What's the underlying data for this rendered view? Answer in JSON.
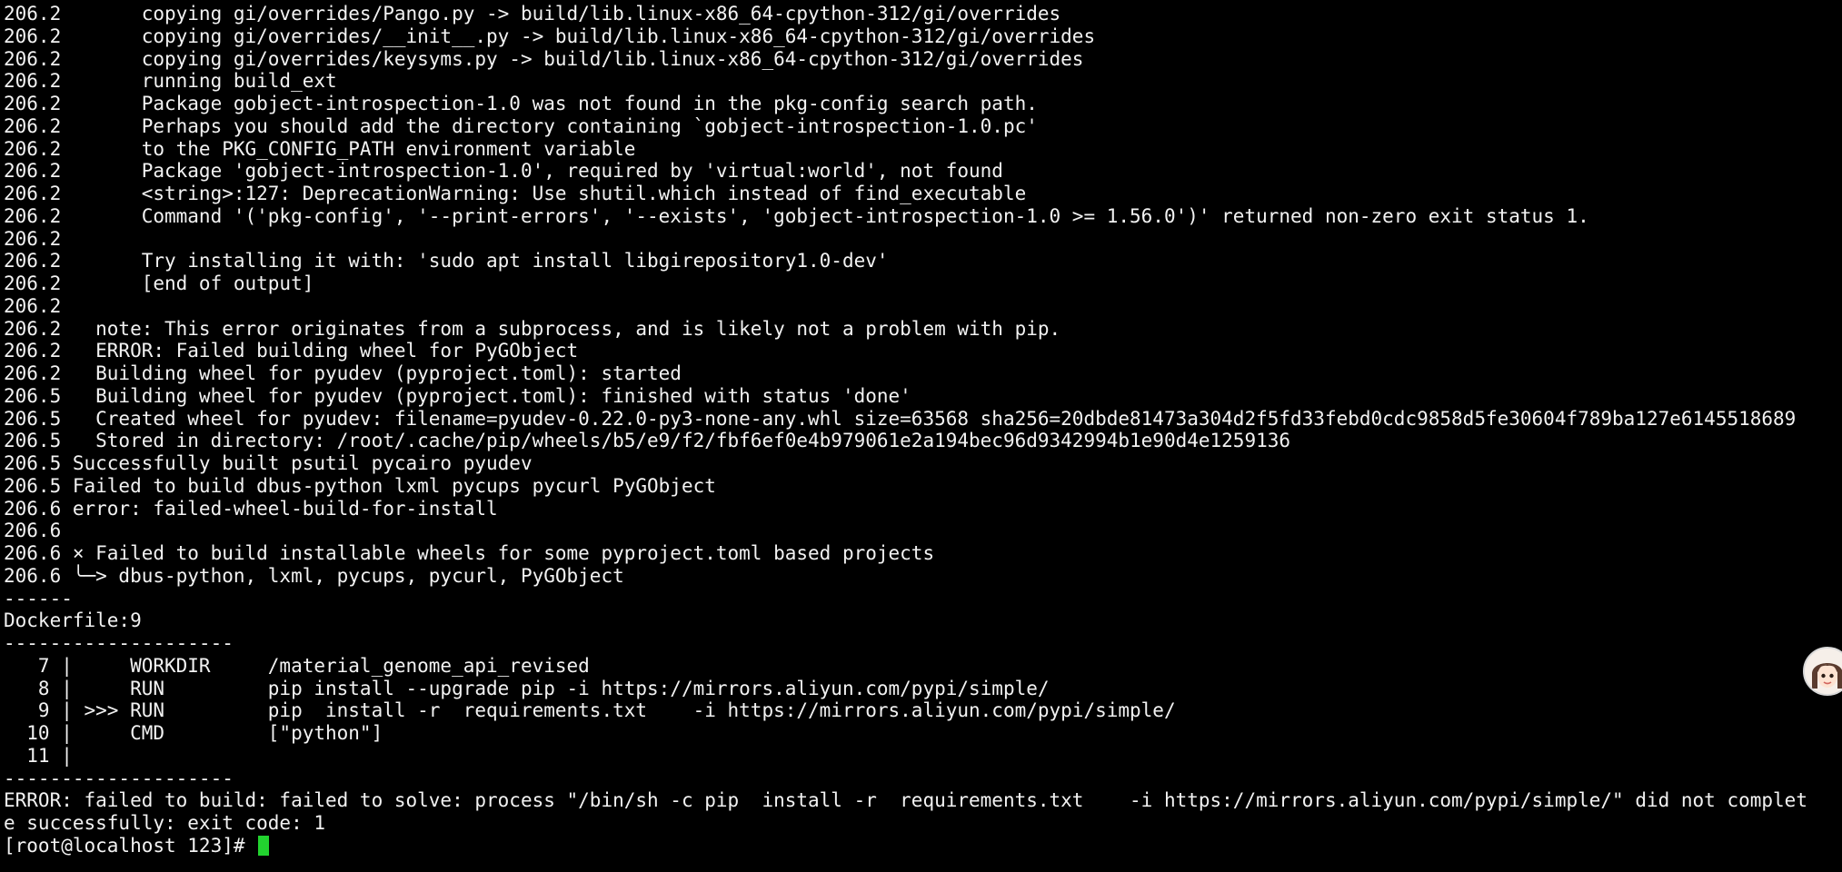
{
  "terminal": {
    "lines": [
      "206.2       copying gi/overrides/Pango.py -> build/lib.linux-x86_64-cpython-312/gi/overrides",
      "206.2       copying gi/overrides/__init__.py -> build/lib.linux-x86_64-cpython-312/gi/overrides",
      "206.2       copying gi/overrides/keysyms.py -> build/lib.linux-x86_64-cpython-312/gi/overrides",
      "206.2       running build_ext",
      "206.2       Package gobject-introspection-1.0 was not found in the pkg-config search path.",
      "206.2       Perhaps you should add the directory containing `gobject-introspection-1.0.pc'",
      "206.2       to the PKG_CONFIG_PATH environment variable",
      "206.2       Package 'gobject-introspection-1.0', required by 'virtual:world', not found",
      "206.2       <string>:127: DeprecationWarning: Use shutil.which instead of find_executable",
      "206.2       Command '('pkg-config', '--print-errors', '--exists', 'gobject-introspection-1.0 >= 1.56.0')' returned non-zero exit status 1.",
      "206.2",
      "206.2       Try installing it with: 'sudo apt install libgirepository1.0-dev'",
      "206.2       [end of output]",
      "206.2",
      "206.2   note: This error originates from a subprocess, and is likely not a problem with pip.",
      "206.2   ERROR: Failed building wheel for PyGObject",
      "206.2   Building wheel for pyudev (pyproject.toml): started",
      "206.5   Building wheel for pyudev (pyproject.toml): finished with status 'done'",
      "206.5   Created wheel for pyudev: filename=pyudev-0.22.0-py3-none-any.whl size=63568 sha256=20dbde81473a304d2f5fd33febd0cdc9858d5fe30604f789ba127e6145518689",
      "206.5   Stored in directory: /root/.cache/pip/wheels/b5/e9/f2/fbf6ef0e4b979061e2a194bec96d9342994b1e90d4e1259136",
      "206.5 Successfully built psutil pycairo pyudev",
      "206.5 Failed to build dbus-python lxml pycups pycurl PyGObject",
      "206.6 error: failed-wheel-build-for-install",
      "206.6",
      "206.6 × Failed to build installable wheels for some pyproject.toml based projects",
      "206.6 ╰─> dbus-python, lxml, pycups, pycurl, PyGObject",
      "------",
      "Dockerfile:9",
      "--------------------",
      "   7 |     WORKDIR     /material_genome_api_revised",
      "   8 |     RUN         pip install --upgrade pip -i https://mirrors.aliyun.com/pypi/simple/",
      "   9 | >>> RUN         pip  install -r  requirements.txt    -i https://mirrors.aliyun.com/pypi/simple/",
      "  10 |     CMD         [\"python\"]",
      "  11 |",
      "--------------------",
      "ERROR: failed to build: failed to solve: process \"/bin/sh -c pip  install -r  requirements.txt    -i https://mirrors.aliyun.com/pypi/simple/\" did not complet",
      "e successfully: exit code: 1"
    ],
    "prompt": "[root@localhost 123]# "
  },
  "colors": {
    "background": "#000000",
    "text": "#f2f2f2",
    "cursor": "#22d32f"
  }
}
